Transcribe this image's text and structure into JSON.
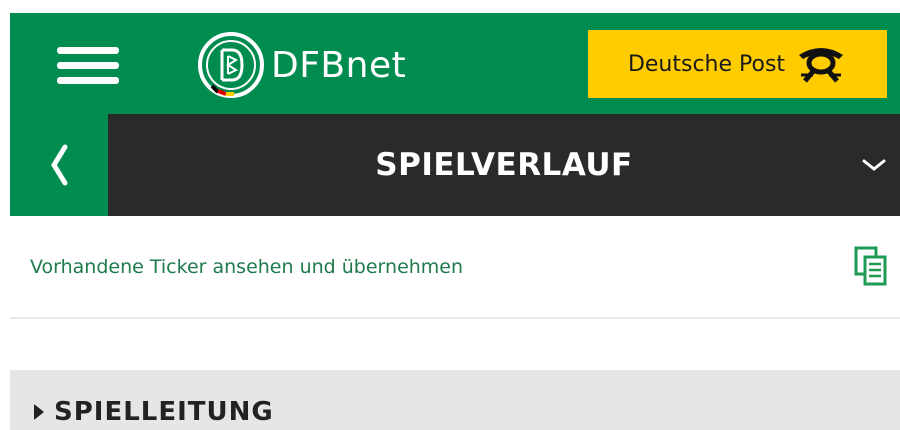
{
  "header": {
    "brand_name": "DFBnet",
    "sponsor_label": "Deutsche Post",
    "colors": {
      "brand_green": "#008c4f",
      "sponsor_yellow": "#ffcc00"
    }
  },
  "titlebar": {
    "title": "SPIELVERLAUF",
    "back_icon": "chevron-left-icon",
    "expand_icon": "chevron-down-icon"
  },
  "ticker": {
    "text": "Vorhandene Ticker ansehen und übernehmen",
    "icon": "copy-document-icon"
  },
  "section": {
    "label": "SPIELLEITUNG",
    "icon": "caret-right-icon"
  }
}
